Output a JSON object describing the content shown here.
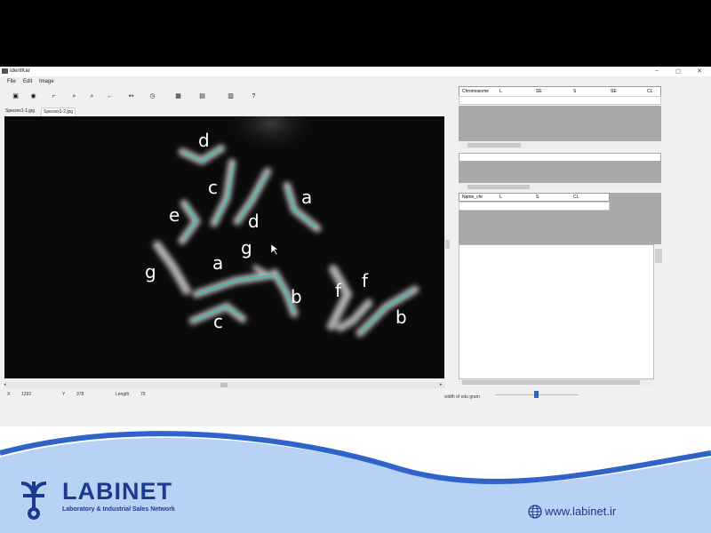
{
  "window": {
    "title": "IdentKar",
    "min": "–",
    "max": "◻",
    "close": "✕"
  },
  "menu": [
    "File",
    "Edit",
    "Image"
  ],
  "toolbar": [
    {
      "icon": "open-icon",
      "glyph": "▣"
    },
    {
      "icon": "camera-icon",
      "glyph": "◉"
    },
    {
      "icon": "crop-icon",
      "glyph": "⌐"
    },
    {
      "icon": "zoom-in-icon",
      "glyph": "⌕"
    },
    {
      "icon": "zoom-out-icon",
      "glyph": "⌕"
    },
    {
      "icon": "arrow-icon",
      "glyph": "←"
    },
    {
      "icon": "undo-icon",
      "glyph": "↤"
    },
    {
      "icon": "clock-icon",
      "glyph": "◷"
    },
    {
      "icon": "karyogram-icon",
      "glyph": "▦"
    },
    {
      "icon": "layout-icon",
      "glyph": "▤"
    },
    {
      "icon": "export-icon",
      "glyph": "▥"
    },
    {
      "icon": "help-icon",
      "glyph": "?"
    }
  ],
  "tabs": [
    "Species1-1.jpg",
    "Species1-2.jpg"
  ],
  "status": {
    "x_label": "X",
    "x_value": "1292",
    "y_label": "Y",
    "y_value": "378",
    "length_label": "Length",
    "length_value": "79"
  },
  "table1_columns": [
    "Chromosome",
    "L",
    "SE",
    "S",
    "SE",
    "CL"
  ],
  "table3_columns": [
    "Name_chr",
    "L",
    "S",
    "CL"
  ],
  "slider": {
    "label": "width of edu gram"
  },
  "chromosome_labels": [
    "d",
    "c",
    "d",
    "a",
    "e",
    "g",
    "g",
    "a",
    "b",
    "f",
    "f",
    "c",
    "b"
  ],
  "footer": {
    "brand": "LABINET",
    "tagline": "Laboratory & Industrial Sales Network",
    "website": "www.labinet.ir"
  },
  "colors": {
    "brand_blue": "#1b3a8f",
    "wave_blue": "#2f63c9",
    "wave_light": "#b8d2f5",
    "trace": "#2fc1b4"
  }
}
